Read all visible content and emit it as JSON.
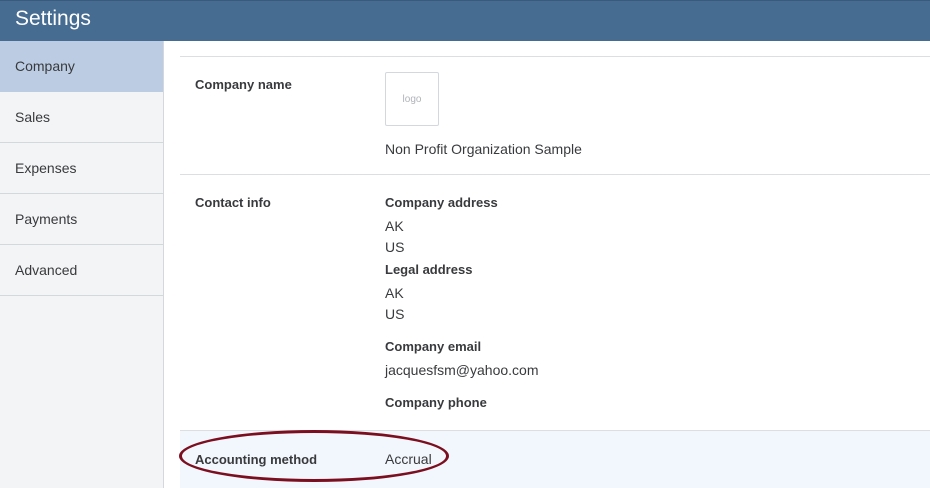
{
  "header": {
    "title": "Settings"
  },
  "sidebar": {
    "items": [
      {
        "label": "Company",
        "active": true
      },
      {
        "label": "Sales",
        "active": false
      },
      {
        "label": "Expenses",
        "active": false
      },
      {
        "label": "Payments",
        "active": false
      },
      {
        "label": "Advanced",
        "active": false
      }
    ]
  },
  "company_name_section": {
    "label": "Company name",
    "logo_placeholder": "logo",
    "value": "Non Profit Organization Sample"
  },
  "contact_info_section": {
    "label": "Contact info",
    "company_address": {
      "label": "Company address",
      "lines": [
        "AK",
        "US"
      ]
    },
    "legal_address": {
      "label": "Legal address",
      "lines": [
        "AK",
        "US"
      ]
    },
    "company_email": {
      "label": "Company email",
      "value": "jacquesfsm@yahoo.com"
    },
    "company_phone": {
      "label": "Company phone"
    }
  },
  "accounting_method_section": {
    "label": "Accounting method",
    "value": "Accrual"
  },
  "colors": {
    "header_bg": "#476c92",
    "sidebar_active": "#bccde3",
    "annotation_oval": "#7b0f1f"
  }
}
